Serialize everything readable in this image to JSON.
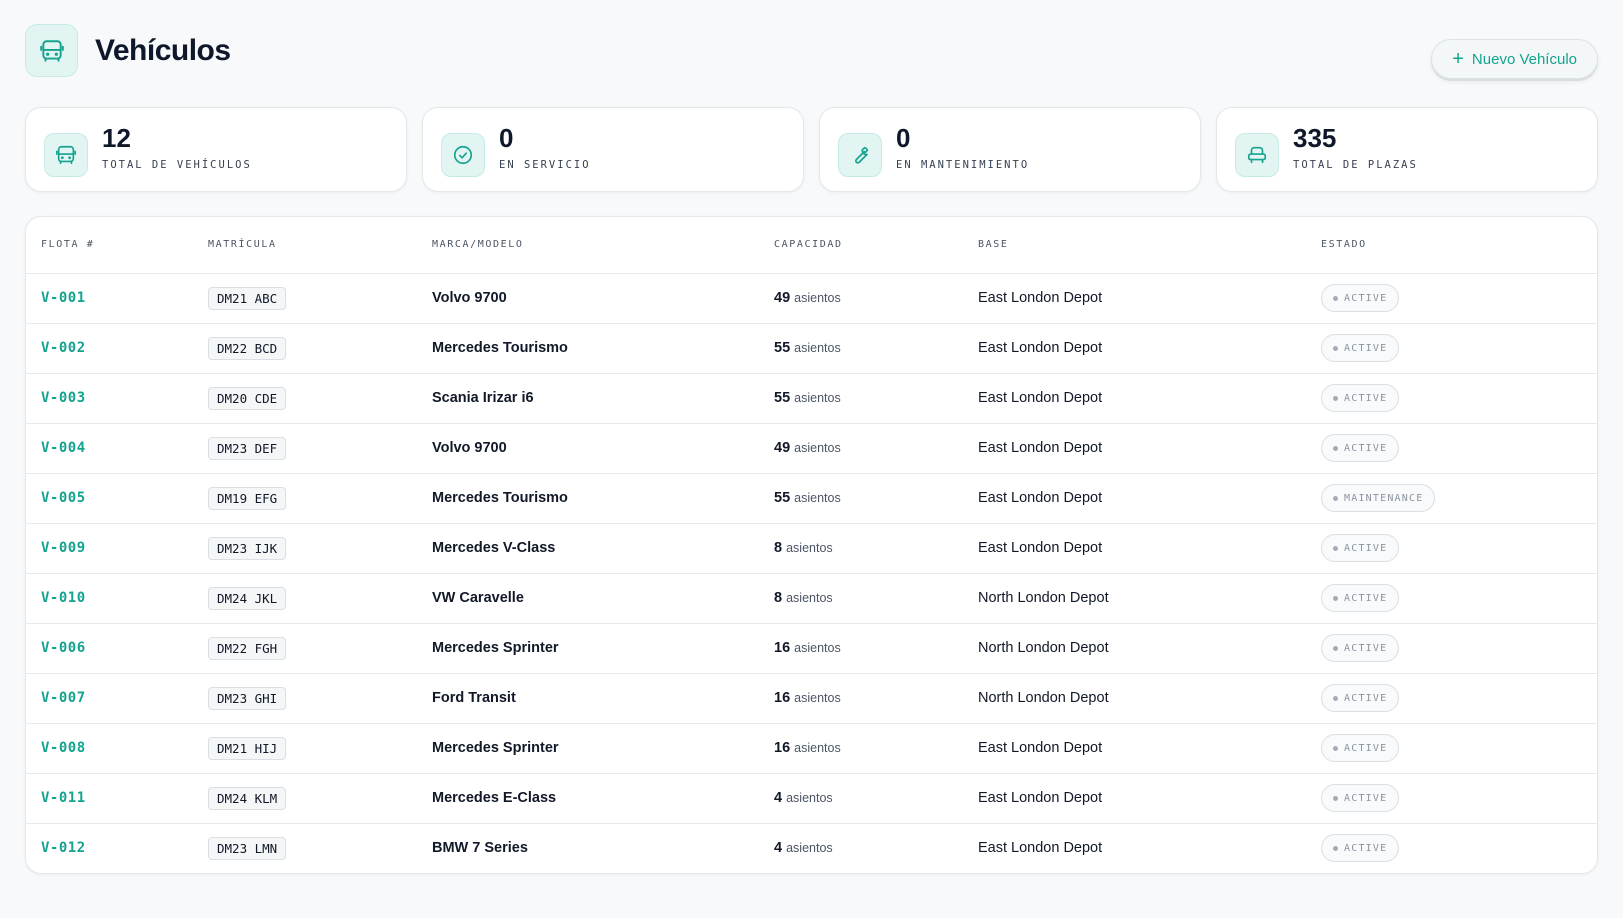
{
  "header": {
    "title": "Vehículos",
    "new_button_plus": "+",
    "new_button_label": "Nuevo Vehículo"
  },
  "stats": [
    {
      "value": "12",
      "label": "TOTAL DE VEHÍCULOS",
      "icon": "bus-icon"
    },
    {
      "value": "0",
      "label": "EN SERVICIO",
      "icon": "check-circle-icon"
    },
    {
      "value": "0",
      "label": "EN MANTENIMIENTO",
      "icon": "wrench-icon"
    },
    {
      "value": "335",
      "label": "TOTAL DE PLAZAS",
      "icon": "seat-icon"
    }
  ],
  "table": {
    "columns": [
      "FLOTA #",
      "MATRÍCULA",
      "MARCA/MODELO",
      "CAPACIDAD",
      "BASE",
      "ESTADO"
    ],
    "capacity_unit": "asientos",
    "rows": [
      {
        "fleet": "V-001",
        "plate": "DM21 ABC",
        "model": "Volvo 9700",
        "capacity": "49",
        "base": "East London Depot",
        "status": "ACTIVE"
      },
      {
        "fleet": "V-002",
        "plate": "DM22 BCD",
        "model": "Mercedes Tourismo",
        "capacity": "55",
        "base": "East London Depot",
        "status": "ACTIVE"
      },
      {
        "fleet": "V-003",
        "plate": "DM20 CDE",
        "model": "Scania Irizar i6",
        "capacity": "55",
        "base": "East London Depot",
        "status": "ACTIVE"
      },
      {
        "fleet": "V-004",
        "plate": "DM23 DEF",
        "model": "Volvo 9700",
        "capacity": "49",
        "base": "East London Depot",
        "status": "ACTIVE"
      },
      {
        "fleet": "V-005",
        "plate": "DM19 EFG",
        "model": "Mercedes Tourismo",
        "capacity": "55",
        "base": "East London Depot",
        "status": "MAINTENANCE"
      },
      {
        "fleet": "V-009",
        "plate": "DM23 IJK",
        "model": "Mercedes V-Class",
        "capacity": "8",
        "base": "East London Depot",
        "status": "ACTIVE"
      },
      {
        "fleet": "V-010",
        "plate": "DM24 JKL",
        "model": "VW Caravelle",
        "capacity": "8",
        "base": "North London Depot",
        "status": "ACTIVE"
      },
      {
        "fleet": "V-006",
        "plate": "DM22 FGH",
        "model": "Mercedes Sprinter",
        "capacity": "16",
        "base": "North London Depot",
        "status": "ACTIVE"
      },
      {
        "fleet": "V-007",
        "plate": "DM23 GHI",
        "model": "Ford Transit",
        "capacity": "16",
        "base": "North London Depot",
        "status": "ACTIVE"
      },
      {
        "fleet": "V-008",
        "plate": "DM21 HIJ",
        "model": "Mercedes Sprinter",
        "capacity": "16",
        "base": "East London Depot",
        "status": "ACTIVE"
      },
      {
        "fleet": "V-011",
        "plate": "DM24 KLM",
        "model": "Mercedes E-Class",
        "capacity": "4",
        "base": "East London Depot",
        "status": "ACTIVE"
      },
      {
        "fleet": "V-012",
        "plate": "DM23 LMN",
        "model": "BMW 7 Series",
        "capacity": "4",
        "base": "East London Depot",
        "status": "ACTIVE"
      }
    ]
  },
  "colors": {
    "accent": "#14a38f",
    "accent_bg": "#e3f5f2",
    "page_bg": "#f7f9fa"
  }
}
